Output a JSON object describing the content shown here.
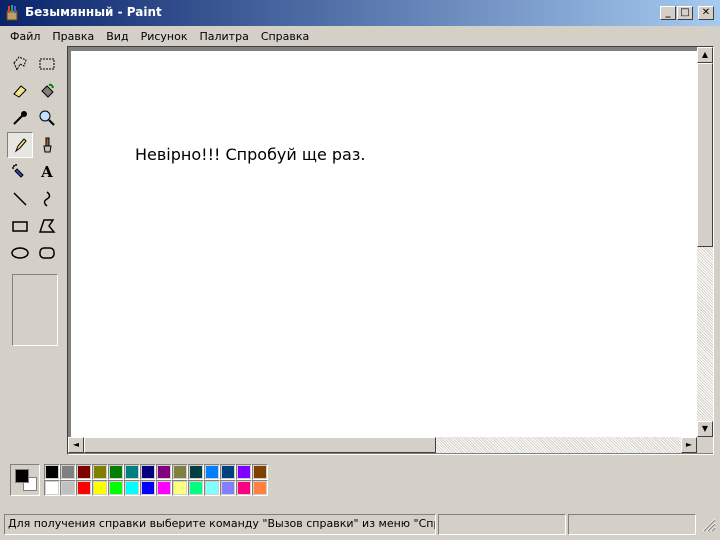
{
  "window": {
    "title": "Безымянный - Paint",
    "minimize_glyph": "_",
    "maximize_glyph": "□",
    "close_glyph": "✕"
  },
  "menu": {
    "items": [
      {
        "label": "Файл"
      },
      {
        "label": "Правка"
      },
      {
        "label": "Вид"
      },
      {
        "label": "Рисунок"
      },
      {
        "label": "Палитра"
      },
      {
        "label": "Справка"
      }
    ]
  },
  "tools": [
    {
      "icon": "free-select-icon"
    },
    {
      "icon": "rect-select-icon"
    },
    {
      "icon": "eraser-icon"
    },
    {
      "icon": "fill-icon"
    },
    {
      "icon": "color-picker-icon"
    },
    {
      "icon": "magnifier-icon"
    },
    {
      "icon": "pencil-icon",
      "selected": true
    },
    {
      "icon": "brush-icon"
    },
    {
      "icon": "airbrush-icon"
    },
    {
      "icon": "text-icon"
    },
    {
      "icon": "line-icon"
    },
    {
      "icon": "curve-icon"
    },
    {
      "icon": "rectangle-icon"
    },
    {
      "icon": "polygon-icon"
    },
    {
      "icon": "ellipse-icon"
    },
    {
      "icon": "rounded-rect-icon"
    }
  ],
  "text_tool_glyph": "A",
  "canvas": {
    "text": "Невірно!!! Спробуй ще раз."
  },
  "scroll": {
    "up": "▲",
    "down": "▼",
    "left": "◄",
    "right": "►"
  },
  "palette": {
    "foreground": "#000000",
    "background": "#ffffff",
    "row1": [
      "#000000",
      "#808080",
      "#800000",
      "#808000",
      "#008000",
      "#008080",
      "#000080",
      "#800080",
      "#808040",
      "#004040",
      "#0080ff",
      "#004080",
      "#8000ff",
      "#804000"
    ],
    "row2": [
      "#ffffff",
      "#c0c0c0",
      "#ff0000",
      "#ffff00",
      "#00ff00",
      "#00ffff",
      "#0000ff",
      "#ff00ff",
      "#ffff80",
      "#00ff80",
      "#80ffff",
      "#8080ff",
      "#ff0080",
      "#ff8040"
    ]
  },
  "status": {
    "message": "Для получения справки выберите команду \"Вызов справки\" из меню \"Справка\".",
    "position": "",
    "size": ""
  }
}
